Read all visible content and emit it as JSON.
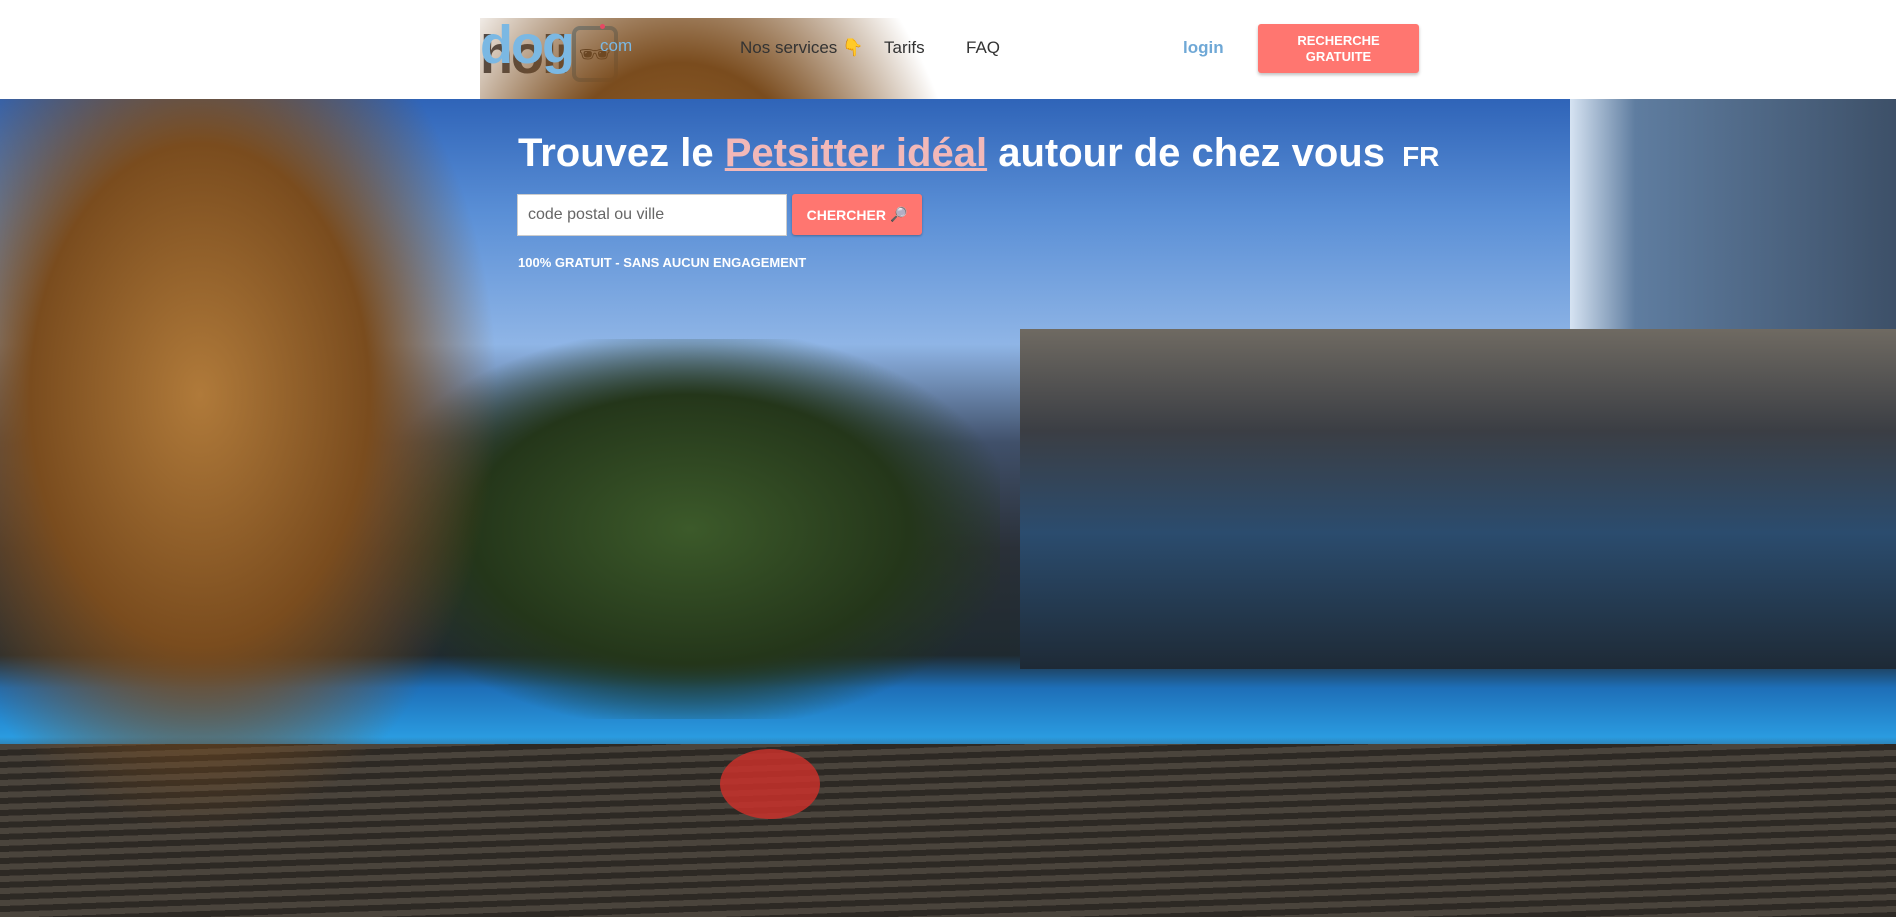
{
  "header": {
    "logo": {
      "main": "holi",
      "accent": "dog",
      "tld": "com"
    },
    "nav": [
      {
        "label": "Nos services",
        "icon": "pointing-down-hand-icon"
      },
      {
        "label": "Tarifs"
      },
      {
        "label": "FAQ"
      }
    ],
    "login_label": "login",
    "cta_label": "RECHERCHE GRATUITE"
  },
  "hero": {
    "headline_pre": "Trouvez le",
    "headline_highlight": "Petsitter idéal",
    "headline_post": "autour de chez vous",
    "country": "FR",
    "search_placeholder": "code postal ou ville",
    "search_button": "CHERCHER",
    "tagline": "100% GRATUIT - SANS AUCUN ENGAGEMENT"
  },
  "colors": {
    "accent": "#ff7670",
    "brand_blue": "#7bb8e3",
    "highlight": "#f2b8b8"
  }
}
